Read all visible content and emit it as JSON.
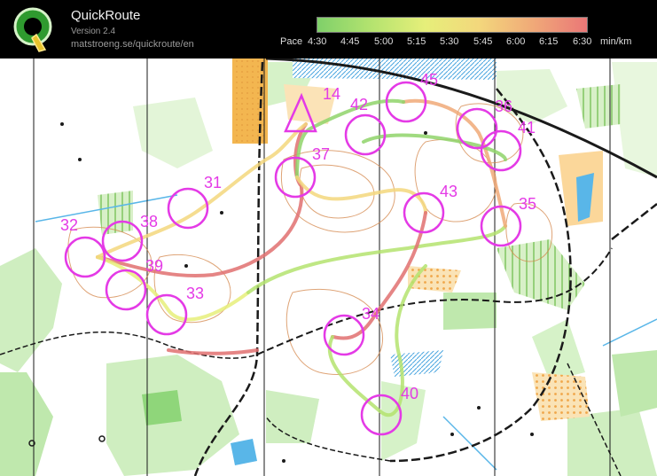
{
  "app": {
    "title": "QuickRoute",
    "version": "Version 2.4",
    "website": "matstroeng.se/quickroute/en"
  },
  "pace_legend": {
    "label": "Pace",
    "ticks": [
      "4:30",
      "4:45",
      "5:00",
      "5:15",
      "5:30",
      "5:45",
      "6:00",
      "6:15",
      "6:30"
    ],
    "unit": "min/km",
    "gradient_colors": [
      "#7fd06a",
      "#b4e36f",
      "#e6ef7a",
      "#f3d77c",
      "#f0a978",
      "#ea7777"
    ]
  },
  "map": {
    "controls": [
      "31",
      "32",
      "33",
      "34",
      "35",
      "36",
      "37",
      "38",
      "39",
      "40",
      "41",
      "42",
      "43",
      "45"
    ],
    "start_label": "14",
    "colors": {
      "control_circle": "#e43ae6",
      "route_slow": "#e07070",
      "route_fast": "#8fd36a",
      "forest_green": "#cfeec0",
      "open_land": "#f3c267",
      "water_blue": "#59b6e8",
      "path_black": "#1a1a1a"
    }
  }
}
